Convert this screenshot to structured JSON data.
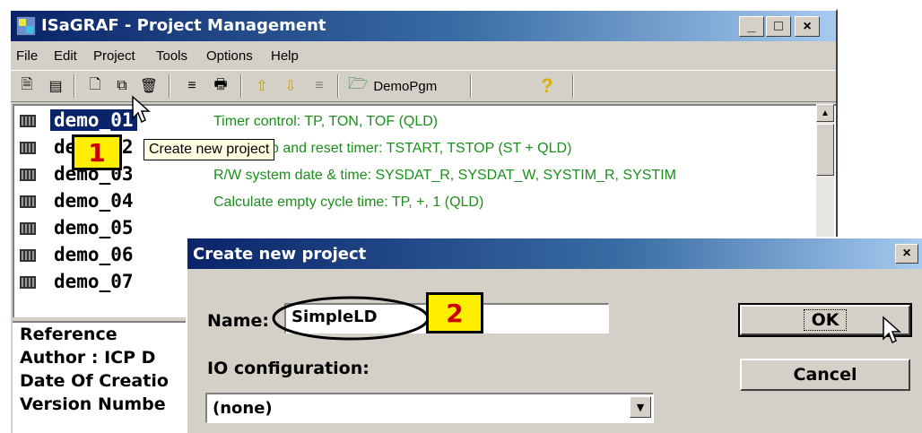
{
  "window": {
    "title": "ISaGRAF - Project Management",
    "caption_buttons": {
      "minimize": "_",
      "maximize": "□",
      "close": "×"
    }
  },
  "menu": [
    "File",
    "Edit",
    "Project",
    "Tools",
    "Options",
    "Help"
  ],
  "toolbar": {
    "project_label": "DemoPgm",
    "icons": [
      "open-icon",
      "properties-icon",
      "new-project-icon",
      "copy-icon",
      "delete-icon",
      "compare-icon",
      "print-icon",
      "upload-icon",
      "download-icon",
      "merge-icon",
      "project-folder-icon",
      "help-icon"
    ]
  },
  "tooltip": "Create new project",
  "projects": [
    {
      "name": "demo_01",
      "desc": "Timer control:  TP, TON, TOF  (QLD)"
    },
    {
      "name": "demo_02",
      "desc": "Start, stop and reset timer:  TSTART, TSTOP  (ST + QLD)"
    },
    {
      "name": "demo_03",
      "desc": "R/W system date & time:  SYSDAT_R, SYSDAT_W, SYSTIM_R, SYSTIM"
    },
    {
      "name": "demo_04",
      "desc": "Calculate empty cycle time:  TP, +, 1  (QLD)"
    },
    {
      "name": "demo_05",
      "desc": ""
    },
    {
      "name": "demo_06",
      "desc": ""
    },
    {
      "name": "demo_07",
      "desc": ""
    }
  ],
  "details": [
    "Reference",
    "Author    : ICP D",
    "Date Of Creatio",
    "Version Numbe"
  ],
  "badges": {
    "step1": "1",
    "step2": "2"
  },
  "dialog": {
    "title": "Create new project",
    "name_label": "Name:",
    "name_value": "SimpleLD",
    "io_label": "IO configuration:",
    "io_value": "(none)",
    "ok_label": "OK",
    "cancel_label": "Cancel",
    "close": "×"
  },
  "colors": {
    "title_bar": "#0a246a",
    "description_text": "#1c8e1c",
    "badge_fill": "#ffee00",
    "badge_text": "#cc0000"
  }
}
